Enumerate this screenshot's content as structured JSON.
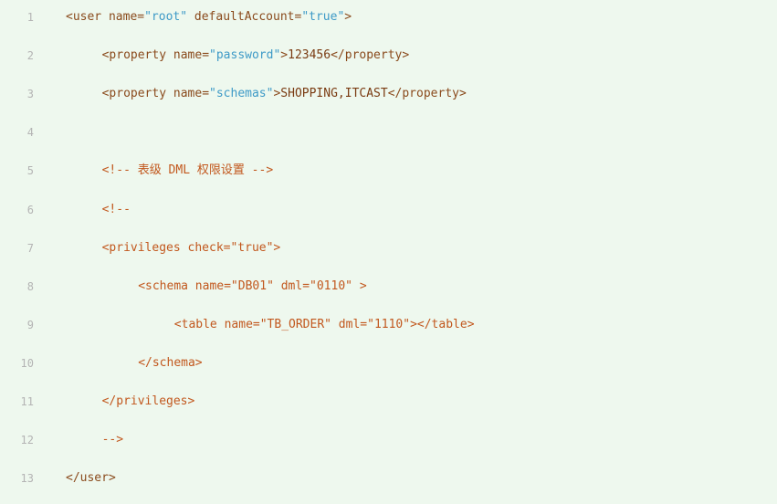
{
  "code_view": {
    "lines": [
      {
        "num": "1",
        "indent": "",
        "tokens": [
          {
            "kind": "punc",
            "text": "<"
          },
          {
            "kind": "tag",
            "text": "user"
          },
          {
            "kind": "attr",
            "text": " name"
          },
          {
            "kind": "punc",
            "text": "="
          },
          {
            "kind": "val",
            "text": "\"root\""
          },
          {
            "kind": "attr",
            "text": " defaultAccount"
          },
          {
            "kind": "punc",
            "text": "="
          },
          {
            "kind": "val",
            "text": "\"true\""
          },
          {
            "kind": "punc",
            "text": ">"
          }
        ]
      },
      {
        "num": "2",
        "indent": "    ",
        "tokens": [
          {
            "kind": "punc",
            "text": "<"
          },
          {
            "kind": "tag",
            "text": "property"
          },
          {
            "kind": "attr",
            "text": " name"
          },
          {
            "kind": "punc",
            "text": "="
          },
          {
            "kind": "val",
            "text": "\"password\""
          },
          {
            "kind": "punc",
            "text": ">"
          },
          {
            "kind": "text",
            "text": "123456"
          },
          {
            "kind": "punc",
            "text": "</"
          },
          {
            "kind": "tag",
            "text": "property"
          },
          {
            "kind": "punc",
            "text": ">"
          }
        ]
      },
      {
        "num": "3",
        "indent": "    ",
        "tokens": [
          {
            "kind": "punc",
            "text": "<"
          },
          {
            "kind": "tag",
            "text": "property"
          },
          {
            "kind": "attr",
            "text": " name"
          },
          {
            "kind": "punc",
            "text": "="
          },
          {
            "kind": "val",
            "text": "\"schemas\""
          },
          {
            "kind": "punc",
            "text": ">"
          },
          {
            "kind": "text",
            "text": "SHOPPING,ITCAST"
          },
          {
            "kind": "punc",
            "text": "</"
          },
          {
            "kind": "tag",
            "text": "property"
          },
          {
            "kind": "punc",
            "text": ">"
          }
        ]
      },
      {
        "num": "4",
        "indent": "",
        "tokens": []
      },
      {
        "num": "5",
        "indent": "    ",
        "tokens": [
          {
            "kind": "comment",
            "text": "<!-- 表级 DML 权限设置 -->"
          }
        ]
      },
      {
        "num": "6",
        "indent": "    ",
        "tokens": [
          {
            "kind": "comment",
            "text": "<!--"
          }
        ]
      },
      {
        "num": "7",
        "indent": "    ",
        "tokens": [
          {
            "kind": "comment",
            "text": "<privileges check=\"true\">"
          }
        ]
      },
      {
        "num": "8",
        "indent": "        ",
        "tokens": [
          {
            "kind": "comment",
            "text": "<schema name=\"DB01\" dml=\"0110\" >"
          }
        ]
      },
      {
        "num": "9",
        "indent": "            ",
        "tokens": [
          {
            "kind": "comment",
            "text": "<table name=\"TB_ORDER\" dml=\"1110\"></table>"
          }
        ]
      },
      {
        "num": "10",
        "indent": "        ",
        "tokens": [
          {
            "kind": "comment",
            "text": "</schema>"
          }
        ]
      },
      {
        "num": "11",
        "indent": "    ",
        "tokens": [
          {
            "kind": "comment",
            "text": "</privileges>"
          }
        ]
      },
      {
        "num": "12",
        "indent": "    ",
        "tokens": [
          {
            "kind": "comment",
            "text": "-->"
          }
        ]
      },
      {
        "num": "13",
        "indent": "",
        "tokens": [
          {
            "kind": "punc",
            "text": "</"
          },
          {
            "kind": "tag",
            "text": "user"
          },
          {
            "kind": "punc",
            "text": ">"
          }
        ]
      }
    ]
  },
  "colors": {
    "background": "#eef8ee",
    "line_number": "#b4b4b4",
    "tag": "#8a4a1c",
    "attribute_value": "#3e9ac7",
    "comment": "#c2581e"
  }
}
